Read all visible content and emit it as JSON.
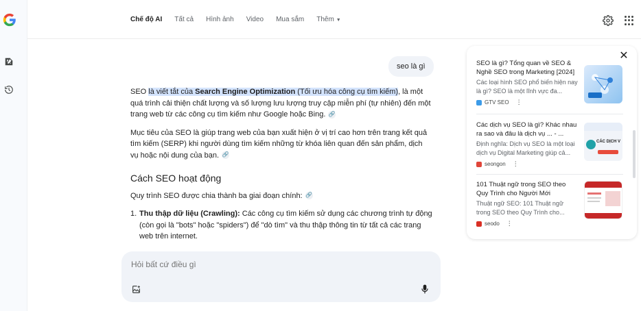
{
  "nav": {
    "tabs": [
      "Chế độ AI",
      "Tất cả",
      "Hình ảnh",
      "Video",
      "Mua sắm",
      "Thêm"
    ],
    "active_index": 0
  },
  "query": "seo là gì",
  "answer": {
    "p1_pre": "SEO ",
    "p1_hl1": "là viết tắt của ",
    "p1_hl_bold": "Search Engine Optimization",
    "p1_hl2": " (Tối ưu hóa công cụ tìm kiếm)",
    "p1_post": ", là một quá trình cải thiện chất lượng và số lượng lưu lượng truy cập miễn phí (tự nhiên) đến một trang web từ các công cụ tìm kiếm như Google hoặc Bing.",
    "p2": "Mục tiêu của SEO là giúp trang web của bạn xuất hiện ở vị trí cao hơn trên trang kết quả tìm kiếm (SERP) khi người dùng tìm kiếm những từ khóa liên quan đến sản phẩm, dịch vụ hoặc nội dung của bạn.",
    "heading": "Cách SEO hoạt động",
    "p3": "Quy trình SEO được chia thành ba giai đoạn chính:",
    "list": [
      {
        "num": "1.",
        "bold": "Thu thập dữ liệu (Crawling):",
        "text": " Các công cụ tìm kiếm sử dụng các chương trình tự động (còn gọi là \"bots\" hoặc \"spiders\") để \"dò tìm\" và thu thập thông tin từ tất cả các trang web trên internet."
      }
    ]
  },
  "prompt": {
    "placeholder": "Hỏi bất cứ điều gì"
  },
  "sources": [
    {
      "title": "SEO là gì? Tổng quan về SEO & Nghề SEO trong Marketing [2024]",
      "snippet": "Các loại hình SEO phổ biến hiện nay là gì? SEO là một lĩnh vực đa...",
      "source": "GTV SEO",
      "thumb_label": "",
      "fav_color": "#3c9be8"
    },
    {
      "title": "Các dịch vụ SEO là gì? Khác nhau ra sao và đâu là dịch vụ ... - ...",
      "snippet": "Định nghĩa: Dịch vụ SEO là một loại dịch vụ Digital Marketing giúp cả...",
      "source": "seongon",
      "thumb_label": "CÁC DỊCH V",
      "fav_color": "#e0463a"
    },
    {
      "title": "101 Thuật ngữ trong SEO theo Quy Trình cho Người Mới",
      "snippet": "Thuật ngữ SEO: 101 Thuật ngữ trong SEO theo Quy Trình cho...",
      "source": "seodo",
      "thumb_label": "",
      "fav_color": "#d93025"
    }
  ],
  "colors": {
    "highlight": "#d3e3fd",
    "bubble": "#f0f3f8",
    "rail": "#f8fafd"
  }
}
